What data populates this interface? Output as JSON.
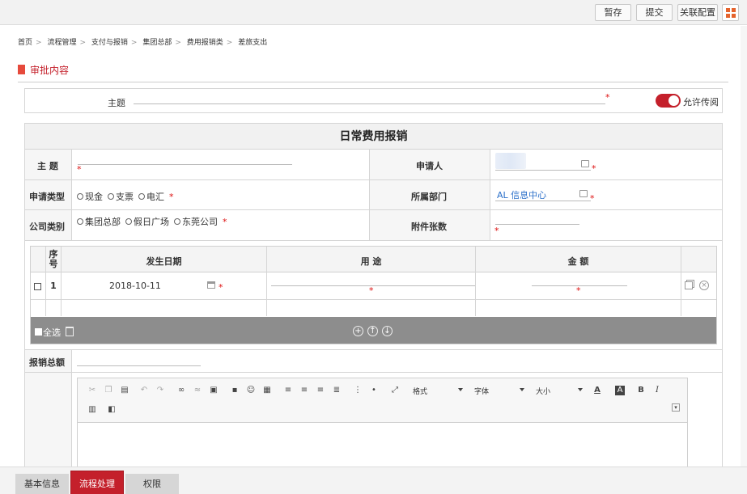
{
  "toolbar": {
    "save_draft": "暂存",
    "submit": "提交",
    "link_config": "关联配置"
  },
  "breadcrumb": [
    "首页",
    "流程管理",
    "支付与报销",
    "集团总部",
    "费用报销类",
    "差旅支出"
  ],
  "section_title": "审批内容",
  "subject_row": {
    "label": "主题",
    "required_mark": "*",
    "toggle_label": "允许传阅",
    "toggle_on": true
  },
  "form": {
    "title": "日常费用报销",
    "fields": {
      "subject_label": "主 题",
      "applicant_label": "申请人",
      "apply_type_label": "申请类型",
      "department_label": "所属部门",
      "department_value": "AL 信息中心",
      "company_type_label": "公司类别",
      "attachments_label": "附件张数",
      "total_label": "报销总额"
    },
    "apply_types": [
      "现金",
      "支票",
      "电汇"
    ],
    "company_types": [
      "集团总部",
      "假日广场",
      "东莞公司"
    ],
    "required_mark": "*"
  },
  "detail_table": {
    "headers": {
      "seq": "序号",
      "date": "发生日期",
      "purpose": "用 途",
      "amount": "金 额"
    },
    "rows": [
      {
        "seq": "1",
        "date": "2018-10-11",
        "purpose": "",
        "amount": ""
      }
    ],
    "select_all": "全选"
  },
  "editor": {
    "format_dd": "格式",
    "font_dd": "字体",
    "size_dd": "大小"
  },
  "bottom_tabs": [
    {
      "label": "基本信息",
      "active": false
    },
    {
      "label": "流程处理",
      "active": true
    },
    {
      "label": "权限",
      "active": false
    }
  ],
  "colors": {
    "accent": "#c4202b",
    "toolbar_bg": "#f2f2f2",
    "table_footer": "#8d8d8d",
    "link_blue": "#2a6fc9"
  }
}
